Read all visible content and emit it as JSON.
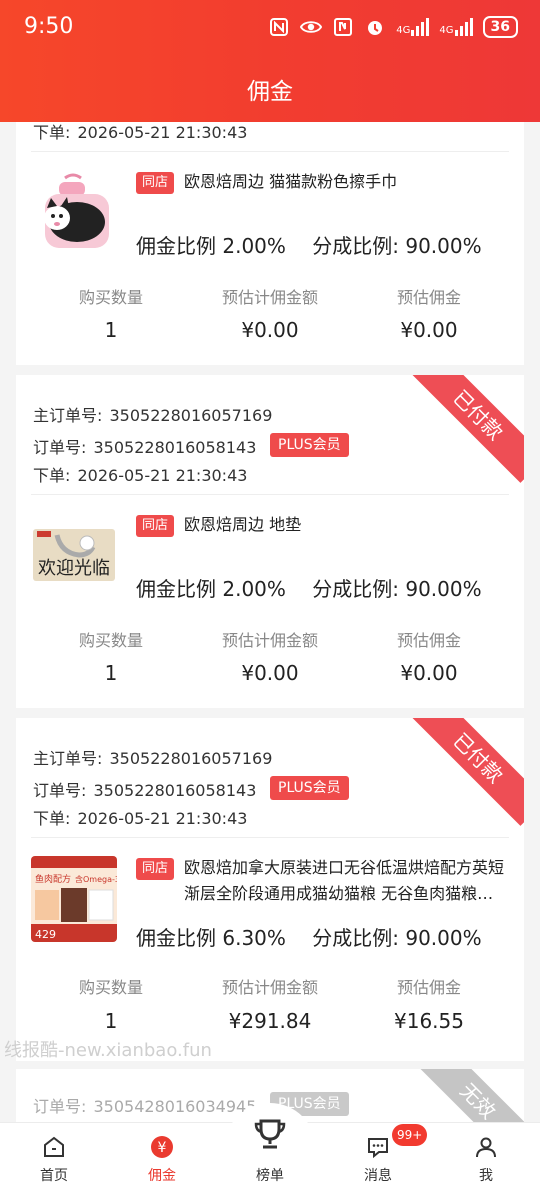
{
  "status_bar": {
    "time": "9:50",
    "network_1": "4G",
    "network_2": "4G",
    "battery": "36"
  },
  "header": {
    "title": "佣金"
  },
  "labels": {
    "main_order": "主订单号:",
    "order": "订单号:",
    "placed": "下单:",
    "qty": "购买数量",
    "est_amount": "预估计佣金额",
    "est_commission": "预估佣金"
  },
  "orders": [
    {
      "placed_time": "2026-05-21 21:30:43",
      "shop_tag": "同店",
      "product": "欧恩焙周边 猫猫款粉色擦手巾",
      "rate": "佣金比例 2.00%",
      "share": "分成比例: 90.00%",
      "qty": "1",
      "est_amount": "¥0.00",
      "est_commission": "¥0.00"
    },
    {
      "ribbon": "已付款",
      "main_order_no": "3505228016057169",
      "order_no": "3505228016058143",
      "plus": "PLUS会员",
      "placed_time": "2026-05-21 21:30:43",
      "shop_tag": "同店",
      "product": "欧恩焙周边 地垫",
      "thumb_text": "欢迎光临",
      "rate": "佣金比例 2.00%",
      "share": "分成比例: 90.00%",
      "qty": "1",
      "est_amount": "¥0.00",
      "est_commission": "¥0.00"
    },
    {
      "ribbon": "已付款",
      "main_order_no": "3505228016057169",
      "order_no": "3505228016058143",
      "plus": "PLUS会员",
      "placed_time": "2026-05-21 21:30:43",
      "shop_tag": "同店",
      "product": "欧恩焙加拿大原装进口无谷低温烘焙配方英短渐层全阶段通用成猫幼猫粮 无谷鱼肉猫粮…",
      "thumb_text_1": "鱼肉配方",
      "thumb_text_2": "含Omega-3",
      "thumb_text_3": "429",
      "rate": "佣金比例 6.30%",
      "share": "分成比例: 90.00%",
      "qty": "1",
      "est_amount": "¥291.84",
      "est_commission": "¥16.55"
    },
    {
      "ribbon": "无效",
      "order_no": "3505428016034945",
      "plus": "PLUS会员"
    }
  ],
  "watermark": "线报酷-new.xianbao.fun",
  "nav": {
    "home": "首页",
    "commission": "佣金",
    "ranking": "榜单",
    "messages": "消息",
    "messages_badge": "99+",
    "me": "我"
  },
  "colors": {
    "accent": "#f23d2f",
    "tag_red": "#ef4b4b",
    "invalid_gray": "#c5c5c5"
  }
}
